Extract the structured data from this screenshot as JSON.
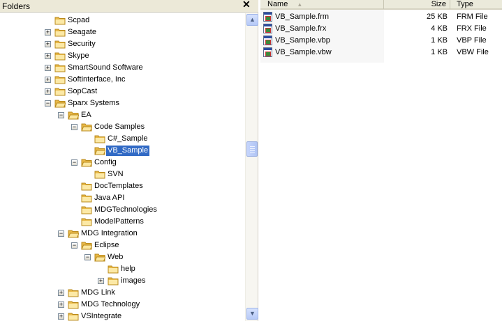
{
  "folders_pane": {
    "title": "Folders",
    "close_label": "✕"
  },
  "tree": [
    {
      "label": "Scpad",
      "level": 1,
      "expander": "none"
    },
    {
      "label": "Seagate",
      "level": 1,
      "expander": "plus"
    },
    {
      "label": "Security",
      "level": 1,
      "expander": "plus"
    },
    {
      "label": "Skype",
      "level": 1,
      "expander": "plus"
    },
    {
      "label": "SmartSound Software",
      "level": 1,
      "expander": "plus"
    },
    {
      "label": "Softinterface, Inc",
      "level": 1,
      "expander": "plus"
    },
    {
      "label": "SopCast",
      "level": 1,
      "expander": "plus"
    },
    {
      "label": "Sparx Systems",
      "level": 1,
      "expander": "minus",
      "open": true
    },
    {
      "label": "EA",
      "level": 2,
      "expander": "minus",
      "open": true
    },
    {
      "label": "Code Samples",
      "level": 3,
      "expander": "minus",
      "open": true
    },
    {
      "label": "C#_Sample",
      "level": 4,
      "expander": "none"
    },
    {
      "label": "VB_Sample",
      "level": 4,
      "expander": "none",
      "open": true,
      "selected": true
    },
    {
      "label": "Config",
      "level": 3,
      "expander": "minus",
      "open": true
    },
    {
      "label": "SVN",
      "level": 4,
      "expander": "none"
    },
    {
      "label": "DocTemplates",
      "level": 3,
      "expander": "none"
    },
    {
      "label": "Java API",
      "level": 3,
      "expander": "none"
    },
    {
      "label": "MDGTechnologies",
      "level": 3,
      "expander": "none"
    },
    {
      "label": "ModelPatterns",
      "level": 3,
      "expander": "none"
    },
    {
      "label": "MDG Integration",
      "level": 2,
      "expander": "minus",
      "open": true
    },
    {
      "label": "Eclipse",
      "level": 3,
      "expander": "minus",
      "open": true
    },
    {
      "label": "Web",
      "level": 4,
      "expander": "minus",
      "open": true
    },
    {
      "label": "help",
      "level": 5,
      "expander": "none"
    },
    {
      "label": "images",
      "level": 5,
      "expander": "plus"
    },
    {
      "label": "MDG Link",
      "level": 2,
      "expander": "plus"
    },
    {
      "label": "MDG Technology",
      "level": 2,
      "expander": "plus"
    },
    {
      "label": "VSIntegrate",
      "level": 2,
      "expander": "plus"
    }
  ],
  "scrollbar": {
    "position_fraction": 0.42
  },
  "file_list": {
    "columns": {
      "name": "Name",
      "size": "Size",
      "type": "Type"
    },
    "sort_indicator": "▲",
    "files": [
      {
        "name": "VB_Sample.frm",
        "size": "25 KB",
        "type": "FRM File"
      },
      {
        "name": "VB_Sample.frx",
        "size": "4 KB",
        "type": "FRX File"
      },
      {
        "name": "VB_Sample.vbp",
        "size": "1 KB",
        "type": "VBP File"
      },
      {
        "name": "VB_Sample.vbw",
        "size": "1 KB",
        "type": "VBW File"
      }
    ]
  },
  "colors": {
    "selection": "#316ac5",
    "folder": "#f5d56b"
  }
}
